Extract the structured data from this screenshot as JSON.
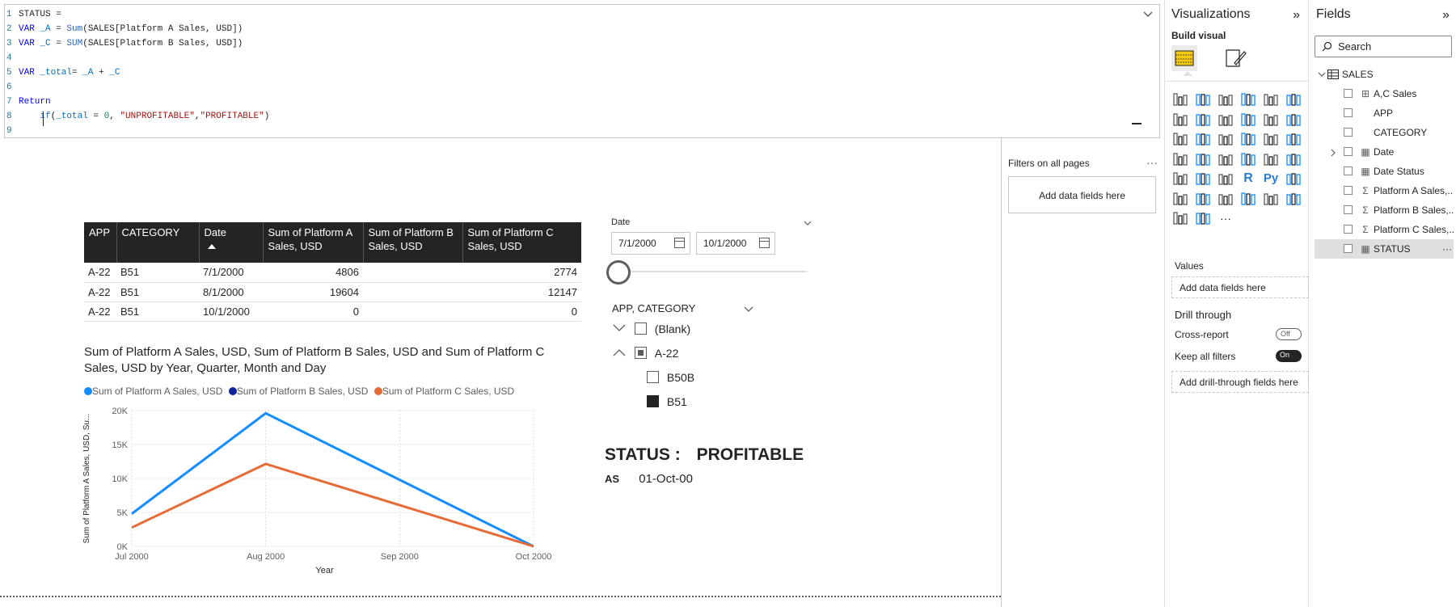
{
  "editor": {
    "lines": [
      {
        "n": "1",
        "tokens": [
          {
            "t": "STATUS =",
            "c": "pl"
          }
        ]
      },
      {
        "n": "2",
        "tokens": [
          {
            "t": "VAR ",
            "c": "kw"
          },
          {
            "t": "_A",
            "c": "var"
          },
          {
            "t": " = ",
            "c": "pl"
          },
          {
            "t": "Sum",
            "c": "fn"
          },
          {
            "t": "(SALES[Platform A Sales, USD])",
            "c": "pl"
          }
        ]
      },
      {
        "n": "3",
        "tokens": [
          {
            "t": "VAR ",
            "c": "kw"
          },
          {
            "t": "_C",
            "c": "var"
          },
          {
            "t": " = ",
            "c": "pl"
          },
          {
            "t": "SUM",
            "c": "fn"
          },
          {
            "t": "(SALES[Platform B Sales, USD])",
            "c": "pl"
          }
        ]
      },
      {
        "n": "4",
        "tokens": []
      },
      {
        "n": "5",
        "tokens": [
          {
            "t": "VAR ",
            "c": "kw"
          },
          {
            "t": "_total",
            "c": "var"
          },
          {
            "t": "= ",
            "c": "pl"
          },
          {
            "t": "_A",
            "c": "var"
          },
          {
            "t": " + ",
            "c": "pl"
          },
          {
            "t": "_C",
            "c": "var"
          }
        ]
      },
      {
        "n": "6",
        "tokens": []
      },
      {
        "n": "7",
        "tokens": [
          {
            "t": "Return",
            "c": "kw"
          }
        ]
      },
      {
        "n": "8",
        "tokens": [
          {
            "t": "    ",
            "c": "pl"
          },
          {
            "t": "if",
            "c": "fn"
          },
          {
            "t": "(",
            "c": "pl"
          },
          {
            "t": "_total",
            "c": "var"
          },
          {
            "t": " = ",
            "c": "pl"
          },
          {
            "t": "0",
            "c": "num"
          },
          {
            "t": ", ",
            "c": "pl"
          },
          {
            "t": "\"UNPROFITABLE\"",
            "c": "str"
          },
          {
            "t": ",",
            "c": "pl"
          },
          {
            "t": "\"PROFITABLE\"",
            "c": "str"
          },
          {
            "t": ")",
            "c": "pl"
          }
        ]
      },
      {
        "n": "9",
        "tokens": []
      }
    ]
  },
  "filters": {
    "title": "Filters on all pages",
    "more": "···",
    "well": "Add data fields here"
  },
  "table": {
    "headers": [
      "APP",
      "CATEGORY",
      "Date",
      "Sum of Platform A Sales, USD",
      "Sum of Platform B Sales, USD",
      "Sum of Platform C Sales, USD"
    ],
    "rows": [
      [
        "A-22",
        "B51",
        "7/1/2000",
        "4806",
        "",
        "2774"
      ],
      [
        "A-22",
        "B51",
        "8/1/2000",
        "19604",
        "",
        "12147"
      ],
      [
        "A-22",
        "B51",
        "10/1/2000",
        "0",
        "",
        "0"
      ]
    ]
  },
  "chart": {
    "title": "Sum of Platform A Sales, USD, Sum of Platform B Sales, USD and Sum of Platform C Sales, USD by Year, Quarter, Month and Day",
    "legend": [
      {
        "label": "Sum of Platform A Sales, USD",
        "color": "#118dff"
      },
      {
        "label": "Sum of Platform B Sales, USD",
        "color": "#12239e"
      },
      {
        "label": "Sum of Platform C Sales, USD",
        "color": "#e66c37"
      }
    ]
  },
  "chart_data": {
    "type": "line",
    "x": [
      "Jul 2000",
      "Aug 2000",
      "Sep 2000",
      "Oct 2000"
    ],
    "xlabel": "Year",
    "ylabel": "Sum of Platform A Sales, USD, Su...",
    "yticks": [
      "0K",
      "5K",
      "10K",
      "15K",
      "20K"
    ],
    "ylim": [
      0,
      20000
    ],
    "grid": true,
    "legend": "top-left",
    "series": [
      {
        "name": "Sum of Platform A Sales, USD",
        "color": "#118dff",
        "points": [
          [
            "Jul 2000",
            4806
          ],
          [
            "Aug 2000",
            19604
          ],
          [
            "Oct 2000",
            0
          ]
        ]
      },
      {
        "name": "Sum of Platform C Sales, USD",
        "color": "#e66c37",
        "points": [
          [
            "Jul 2000",
            2774
          ],
          [
            "Aug 2000",
            12147
          ],
          [
            "Oct 2000",
            0
          ]
        ]
      }
    ]
  },
  "dateSlicer": {
    "title": "Date",
    "from": "7/1/2000",
    "to": "10/1/2000",
    "position": 0
  },
  "catSlicer": {
    "title": "APP, CATEGORY",
    "items": {
      "blank": "(Blank)",
      "a22": "A-22",
      "b50b": "B50B",
      "b51": "B51"
    }
  },
  "status": {
    "label": "STATUS :",
    "value": "PROFITABLE",
    "as_label": "AS",
    "as_value": "01-Oct-00"
  },
  "viz": {
    "title": "Visualizations",
    "build": "Build visual",
    "values": "Values",
    "values_well": "Add data fields here",
    "drill": "Drill through",
    "cross": "Cross-report",
    "cross_state": "Off",
    "keep": "Keep all filters",
    "keep_state": "On",
    "drill_well": "Add drill-through fields here",
    "more": "···"
  },
  "fields": {
    "title": "Fields",
    "search_placeholder": "Search",
    "table": "SALES",
    "items": [
      "A,C Sales",
      "APP",
      "CATEGORY",
      "Date",
      "Date Status",
      "Platform A Sales,...",
      "Platform B Sales,...",
      "Platform C Sales,...",
      "STATUS"
    ],
    "item_more": "···"
  }
}
